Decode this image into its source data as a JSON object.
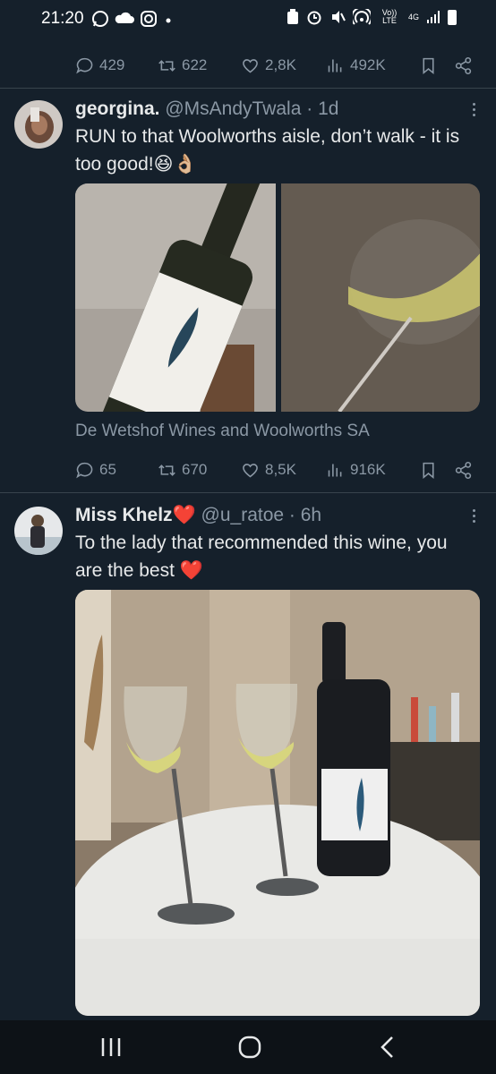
{
  "status_bar": {
    "time": "21:20",
    "left_icons": [
      "whatsapp-icon",
      "cloud-icon",
      "instagram-icon",
      "dot-icon"
    ],
    "right_icons": [
      "battery-saver-icon",
      "alarm-icon",
      "mute-icon",
      "hotspot-icon",
      "volte-icon",
      "4g-icon",
      "signal-icon",
      "battery-icon"
    ],
    "volte": "Vo)) LTE",
    "net": "4G"
  },
  "top_actions": {
    "replies": "429",
    "reposts": "622",
    "likes": "2,8K",
    "views": "492K"
  },
  "tweets": [
    {
      "name": "georgina.",
      "handle": "@MsAndyTwala",
      "time": "· 1d",
      "text": "RUN to that Woolworths aisle, don’t walk - it is too good!😆👌🏼",
      "card_source": "De Wetshof Wines and Woolworths SA",
      "actions": {
        "replies": "65",
        "reposts": "670",
        "likes": "8,5K",
        "views": "916K"
      }
    },
    {
      "name": "Miss Khelz❤️",
      "handle": "@u_ratoe",
      "time": "· 6h",
      "text": "To the lady that recommended this wine, you are the best ❤️"
    }
  ],
  "bottom_nav": [
    "recents-icon",
    "home-icon",
    "back-icon"
  ],
  "colors": {
    "background": "#15202b",
    "secondary_text": "#8b98a5",
    "divider": "#38444d",
    "nav_bar": "#0d1217"
  }
}
